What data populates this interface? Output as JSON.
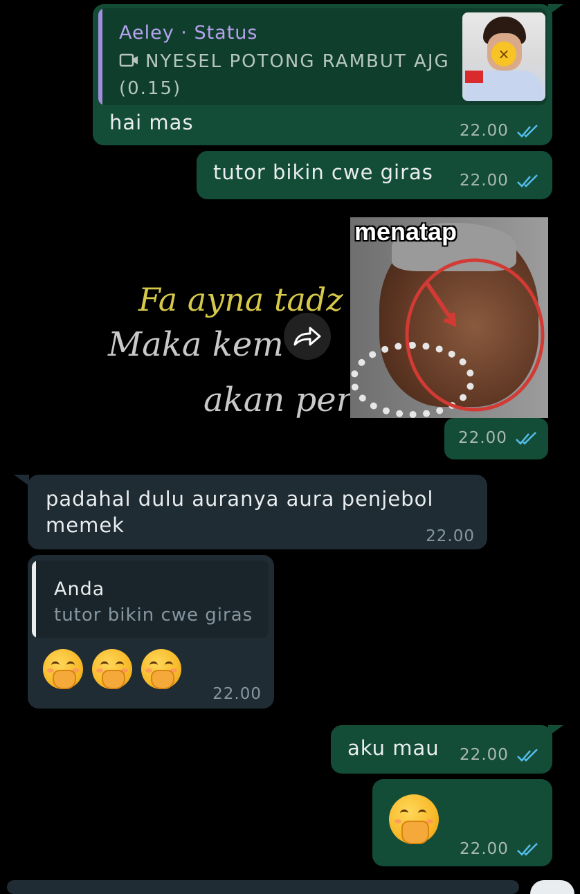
{
  "colors": {
    "outgoing_bubble": "#144d37",
    "incoming_bubble": "#1f2c34",
    "read_ticks": "#53bdeb",
    "status_bar_accent": "#a48ee0"
  },
  "messages": {
    "m1": {
      "quote_author": "Aeley · Status",
      "quote_icon": "video-icon",
      "quote_text": "NYESEL POTONG RAMBUT AJG (0.15)",
      "text": "hai mas",
      "time": "22.00"
    },
    "m2": {
      "text": "tutor bikin cwe giras",
      "time": "22.00"
    },
    "m3": {
      "background_line1": "Fa ayna tadz",
      "background_line2": "Maka kem",
      "background_line3": "akan per",
      "sticker_caption": "menatap",
      "forward_icon": "forward-icon",
      "time": "22.00"
    },
    "m4": {
      "text": "padahal dulu auranya aura penjebol memek",
      "time": "22.00"
    },
    "m5": {
      "quote_author": "Anda",
      "quote_text": "tutor bikin cwe giras",
      "emoji_icons": [
        "face-with-hand-over-mouth-emoji",
        "face-with-hand-over-mouth-emoji",
        "face-with-hand-over-mouth-emoji"
      ],
      "time": "22.00"
    },
    "m6": {
      "text": "aku mau",
      "time": "22.00"
    },
    "m7": {
      "emoji_icon": "face-with-hand-over-mouth-emoji",
      "time": "22.00"
    }
  }
}
